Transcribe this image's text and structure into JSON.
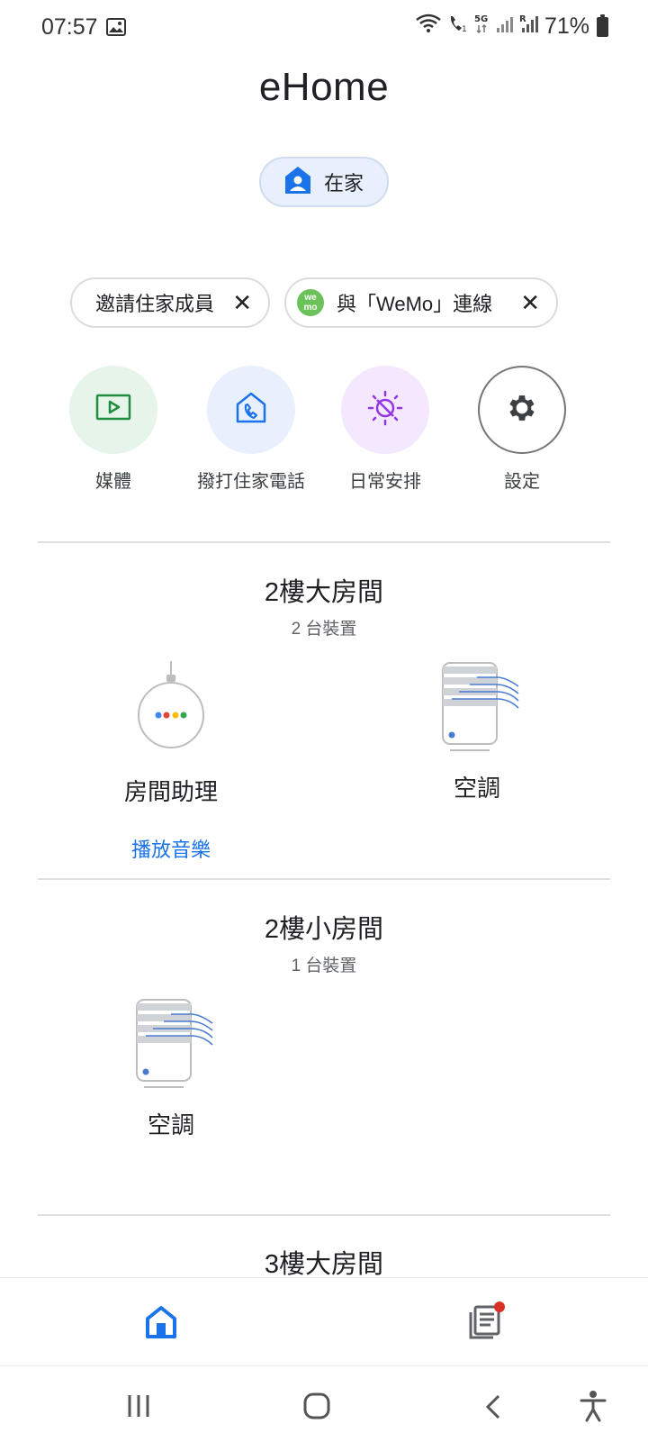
{
  "status": {
    "time": "07:57",
    "battery": "71%"
  },
  "app": {
    "title": "eHome"
  },
  "home_chip": {
    "label": "在家"
  },
  "chips": [
    {
      "label": "邀請住家成員"
    },
    {
      "label": "與「WeMo」連線",
      "logo_text_top": "we",
      "logo_text_bottom": "mo"
    }
  ],
  "quick_actions": [
    {
      "label": "媒體"
    },
    {
      "label": "撥打住家電話"
    },
    {
      "label": "日常安排"
    },
    {
      "label": "設定"
    }
  ],
  "rooms": [
    {
      "title": "2樓大房間",
      "subtitle": "2 台裝置",
      "devices": [
        {
          "name": "房間助理",
          "action": "播放音樂"
        },
        {
          "name": "空調"
        }
      ]
    },
    {
      "title": "2樓小房間",
      "subtitle": "1 台裝置",
      "devices": [
        {
          "name": "空調"
        }
      ]
    },
    {
      "title": "3樓大房間"
    }
  ],
  "colors": {
    "accent": "#1a73e8",
    "chip_bg": "#e8f0fe",
    "media_bg": "#e6f4ea",
    "call_bg": "#e8f0fe",
    "routine_bg": "#f3e8fd"
  }
}
